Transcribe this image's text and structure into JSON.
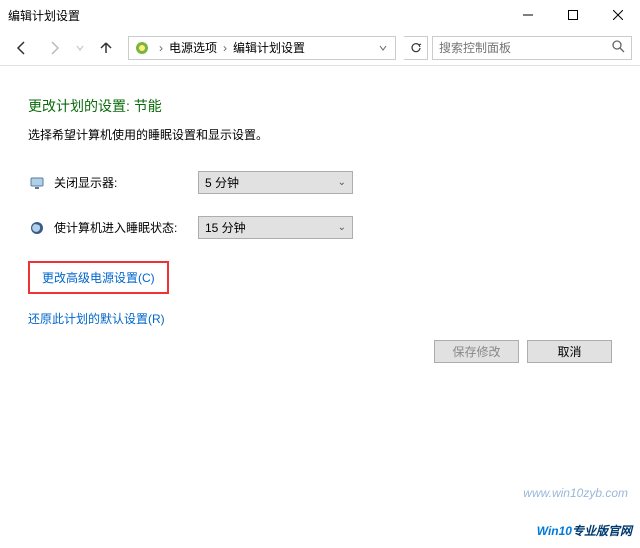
{
  "titlebar": {
    "title": "编辑计划设置"
  },
  "toolbar": {
    "breadcrumb": {
      "item1": "电源选项",
      "item2": "编辑计划设置"
    },
    "search_placeholder": "搜索控制面板"
  },
  "page": {
    "heading": "更改计划的设置: 节能",
    "subtext": "选择希望计算机使用的睡眠设置和显示设置。",
    "turn_off_display": {
      "label": "关闭显示器:",
      "value": "5 分钟"
    },
    "sleep": {
      "label": "使计算机进入睡眠状态:",
      "value": "15 分钟"
    },
    "advanced_link": "更改高级电源设置(C)",
    "restore_link": "还原此计划的默认设置(R)"
  },
  "buttons": {
    "save": "保存修改",
    "cancel": "取消"
  },
  "footer": {
    "watermark": "www.win10zyb.com",
    "brand_prefix": "Win10",
    "brand_suffix": "专业版官网"
  }
}
